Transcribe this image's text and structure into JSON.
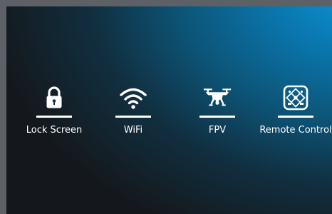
{
  "colors": {
    "background_dark": "#14181c",
    "background_accent": "#0d96d6",
    "foreground": "#ffffff",
    "frame": "#5d6166"
  },
  "menu": {
    "items": [
      {
        "label": "Lock Screen",
        "icon": "lock-icon"
      },
      {
        "label": "WiFi",
        "icon": "wifi-icon"
      },
      {
        "label": "FPV",
        "icon": "drone-icon"
      },
      {
        "label": "Remote Control",
        "icon": "remote-control-icon"
      }
    ]
  }
}
